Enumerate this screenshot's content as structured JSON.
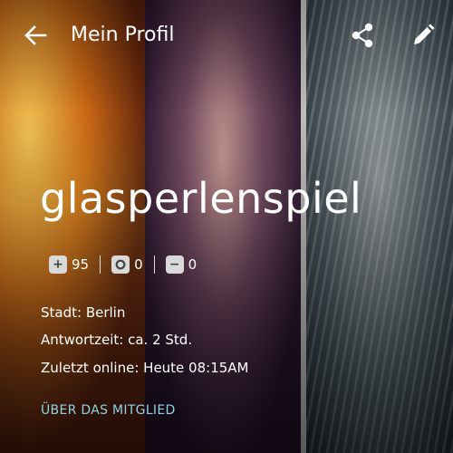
{
  "header": {
    "title": "Mein Profil",
    "back_icon": "arrow-left-icon",
    "share_icon": "share-icon",
    "edit_icon": "pencil-icon"
  },
  "profile": {
    "username": "glasperlenspiel",
    "stats": [
      {
        "icon": "plus-icon",
        "value": "95"
      },
      {
        "icon": "circle-speech-icon",
        "value": "0"
      },
      {
        "icon": "minus-icon",
        "value": "0"
      }
    ],
    "city": "Stadt: Berlin",
    "response_time": "Antwortzeit:  ca. 2 Std.",
    "last_online": "Zuletzt online: Heute 08:15AM",
    "about_link": "ÜBER DAS MITGLIED"
  },
  "colors": {
    "accent_link": "#8fd3e0",
    "icon_bg": "#d9d9d9",
    "text": "#ffffff"
  }
}
